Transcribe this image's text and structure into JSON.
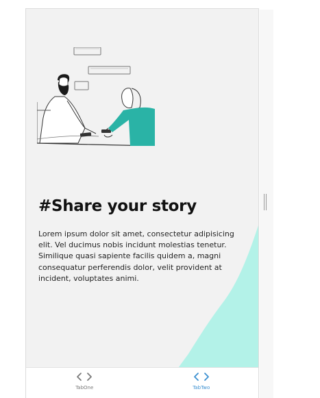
{
  "screen": {
    "title": "#Share your story",
    "body": "Lorem ipsum dolor sit amet, consectetur adipisicing elit. Vel ducimus nobis incidunt molestias tenetur. Similique quasi sapiente facilis quidem a, magni consequatur perferendis dolor, velit provident at incident, voluptates animi.",
    "illustration_icon": "people-sharing-phone-illustration"
  },
  "tabbar": {
    "tabs": [
      {
        "label": "TabOne",
        "icon": "code-icon",
        "active": false
      },
      {
        "label": "TabTwo",
        "icon": "code-icon",
        "active": true
      }
    ]
  },
  "colors": {
    "background": "#f2f2f2",
    "accent_blob": "#b3f2e8",
    "shirt": "#2ab3a6",
    "tab_inactive": "#7a7a7a",
    "tab_active": "#3a8fd0"
  }
}
